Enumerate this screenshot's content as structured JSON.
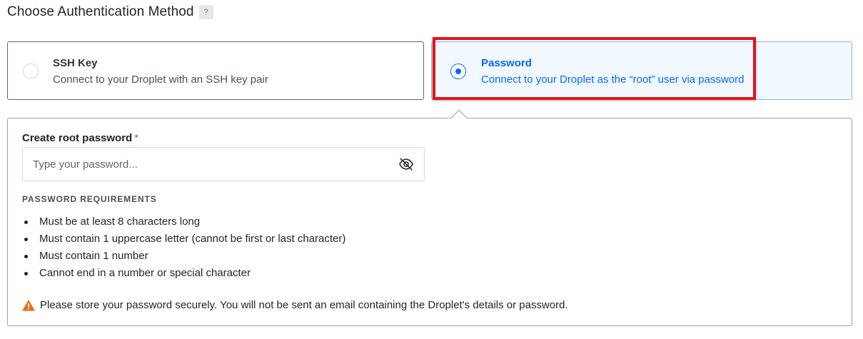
{
  "header": {
    "title": "Choose Authentication Method",
    "help_label": "?"
  },
  "options": [
    {
      "key": "ssh",
      "title": "SSH Key",
      "description": "Connect to your Droplet with an SSH key pair",
      "selected": false
    },
    {
      "key": "password",
      "title": "Password",
      "description": "Connect to your Droplet as the “root” user via password",
      "selected": true
    }
  ],
  "password_panel": {
    "field_label": "Create root password",
    "required_mark": "*",
    "input": {
      "value": "",
      "placeholder": "Type your password..."
    },
    "requirements_heading": "PASSWORD REQUIREMENTS",
    "requirements": [
      "Must be at least 8 characters long",
      "Must contain 1 uppercase letter (cannot be first or last character)",
      "Must contain 1 number",
      "Cannot end in a number or special character"
    ],
    "warning": "Please store your password securely. You will not be sent an email containing the Droplet's details or password."
  },
  "colors": {
    "accent": "#0069ff",
    "highlight": "#e2141a",
    "warning": "#e8711c",
    "required": "#e5433a"
  },
  "icons": {
    "help": "question-icon",
    "toggle_visibility": "eye-slash-icon",
    "warning": "warning-triangle-icon"
  }
}
